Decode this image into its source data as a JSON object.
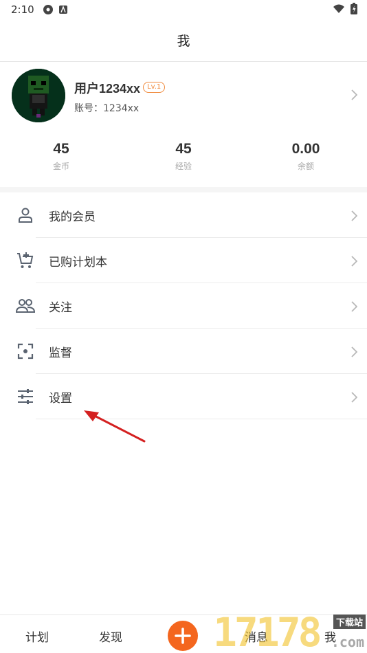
{
  "status_bar": {
    "time": "2:10"
  },
  "header": {
    "title": "我"
  },
  "profile": {
    "username": "用户1234xx",
    "level": "Lv.1",
    "account": "账号：1234xx"
  },
  "stats": [
    {
      "value": "45",
      "label": "金币"
    },
    {
      "value": "45",
      "label": "经验"
    },
    {
      "value": "0.00",
      "label": "余额"
    }
  ],
  "menu": [
    {
      "label": "我的会员",
      "icon": "person-icon"
    },
    {
      "label": "已购计划本",
      "icon": "cart-plus-icon"
    },
    {
      "label": "关注",
      "icon": "people-icon"
    },
    {
      "label": "监督",
      "icon": "focus-frame-icon"
    },
    {
      "label": "设置",
      "icon": "sliders-icon"
    }
  ],
  "bottom_nav": {
    "plan": "计划",
    "discover": "发现",
    "messages": "消息",
    "me": "我"
  },
  "watermark": {
    "digits": "17178",
    "tag": "下载站",
    "suffix": ".com"
  },
  "colors": {
    "accent": "#f4661e",
    "badge": "#f08a3c",
    "annotation_arrow": "#d42020"
  }
}
